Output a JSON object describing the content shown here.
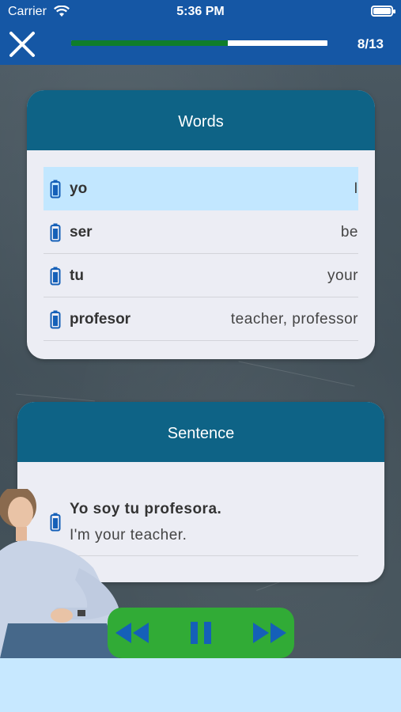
{
  "status_bar": {
    "carrier": "Carrier",
    "time": "5:36 PM"
  },
  "header": {
    "counter": "8/13",
    "progress": 0.61
  },
  "words": {
    "title": "Words",
    "items": [
      {
        "es": "yo",
        "en": "I"
      },
      {
        "es": "ser",
        "en": "be"
      },
      {
        "es": "tu",
        "en": "your"
      },
      {
        "es": "profesor",
        "en": "teacher, professor"
      }
    ]
  },
  "sentence": {
    "title": "Sentence",
    "es": "Yo soy tu profesora.",
    "en": "I'm your teacher."
  },
  "colors": {
    "header_blue": "#1557a5",
    "card_header": "#0e6386",
    "highlight": "#c2e7ff",
    "controls_green": "#31ab36",
    "progress_green": "#0f7d2a"
  },
  "icons": [
    "wifi-icon",
    "battery-icon",
    "close-icon",
    "speaker-icon",
    "rewind-icon",
    "pause-icon",
    "fast-forward-icon"
  ]
}
